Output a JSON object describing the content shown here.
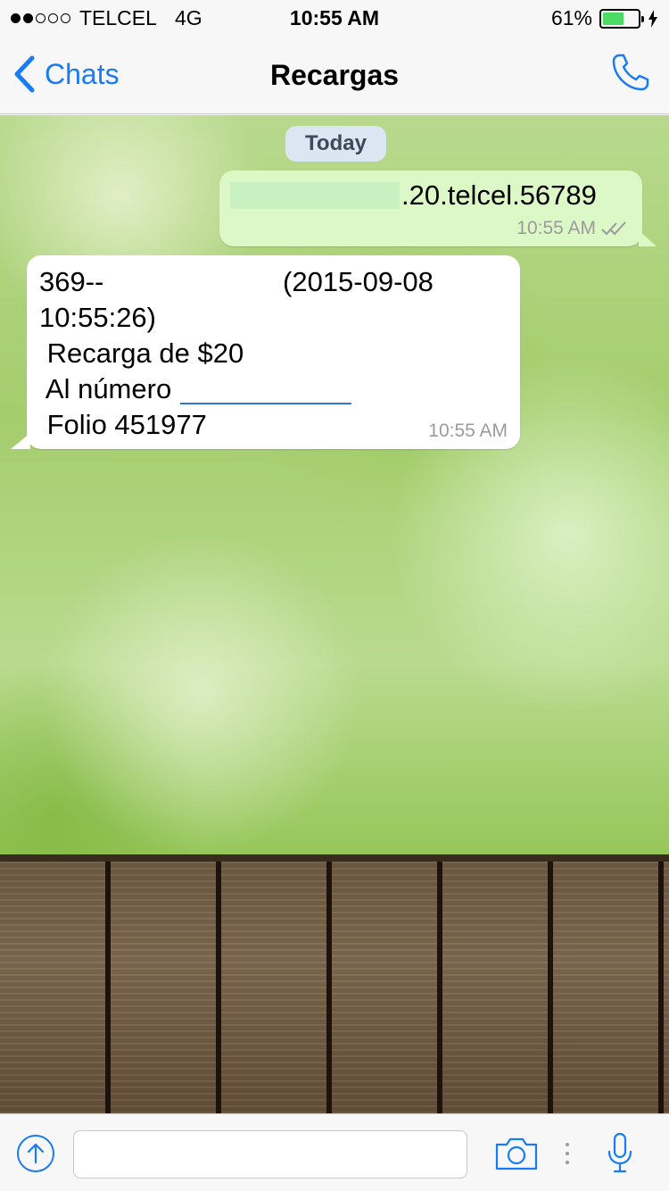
{
  "status_bar": {
    "carrier": "TELCEL",
    "network": "4G",
    "time": "10:55 AM",
    "battery_percent": "61%",
    "battery_level": 0.61,
    "signal_bars_filled": 2,
    "signal_bars_total": 5
  },
  "nav": {
    "back_label": "Chats",
    "title": "Recargas",
    "icons": {
      "back": "chevron-left-icon",
      "call": "phone-icon"
    }
  },
  "chat": {
    "date_label": "Today",
    "messages": [
      {
        "direction": "outgoing",
        "text": ".20.telcel.56789",
        "time": "10:55 AM",
        "status": "read"
      },
      {
        "direction": "incoming",
        "lines": [
          "369--",
          "(2015-09-08",
          "10:55:26)",
          " Recarga de $20",
          " Al número",
          " Folio 451977"
        ],
        "time": "10:55 AM"
      }
    ]
  },
  "input_bar": {
    "placeholder": "",
    "icons": [
      "share-icon",
      "camera-icon",
      "microphone-icon"
    ]
  },
  "colors": {
    "accent": "#1a7cf5",
    "outgoing_bubble": "#dcf8c6",
    "incoming_bubble": "#ffffff",
    "battery": "#4cd964"
  }
}
